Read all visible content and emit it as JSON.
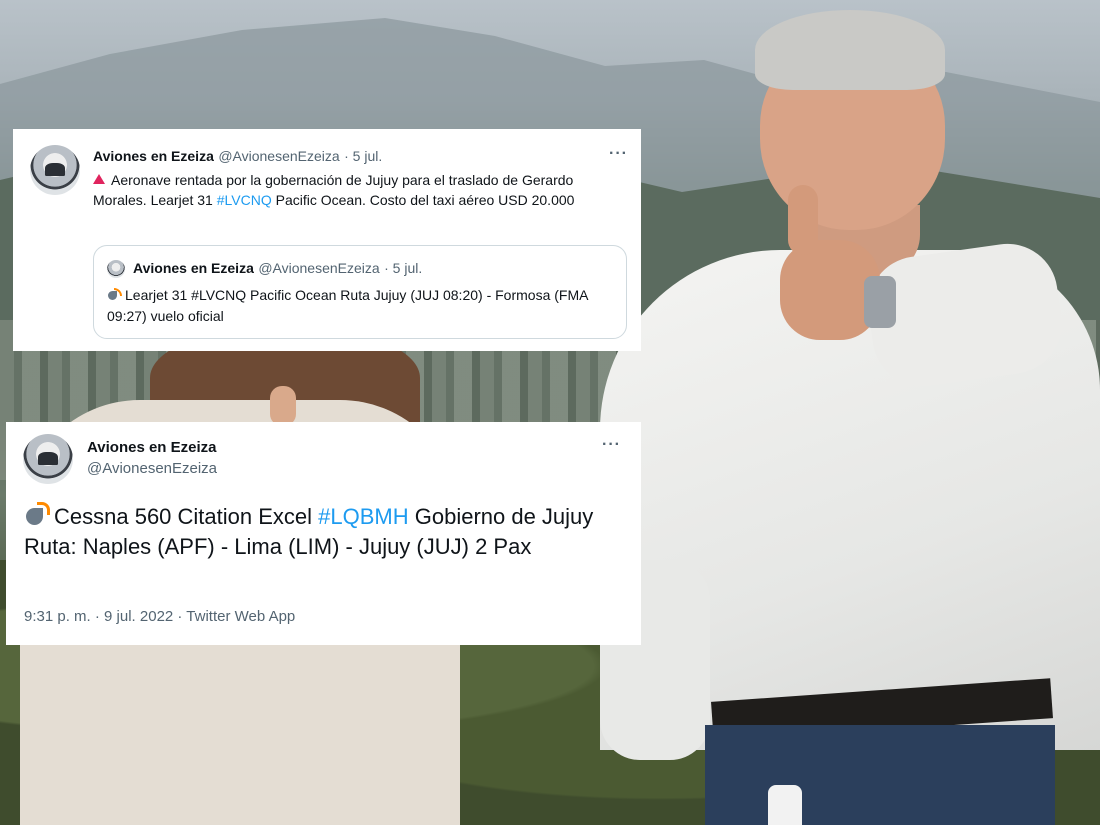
{
  "tweet_quote": {
    "author_name": "Aviones en Ezeiza",
    "author_handle": "@AvionesenEzeiza",
    "date": "· 5 jul.",
    "more": "···",
    "text_before": "Aeronave rentada por la gobernación de Jujuy para el traslado de Gerardo Morales. Learjet 31 ",
    "hashtag": "#LVCNQ",
    "text_after": " Pacific Ocean. Costo del taxi aéreo USD 20.000",
    "quoted": {
      "author_name": "Aviones en Ezeiza",
      "author_handle": "@AvionesenEzeiza",
      "date": "· 5 jul.",
      "text": "Learjet 31 #LVCNQ Pacific Ocean Ruta Jujuy (JUJ 08:20) - Formosa (FMA 09:27) vuelo oficial"
    }
  },
  "tweet_main": {
    "author_name": "Aviones en Ezeiza",
    "author_handle": "@AvionesenEzeiza",
    "more": "···",
    "text_before": "Cessna 560 Citation Excel ",
    "hashtag": "#LQBMH",
    "text_after": " Gobierno de Jujuy Ruta: Naples (APF) - Lima (LIM) - Jujuy (JUJ) 2 Pax",
    "meta": "9:31 p. m. · 9 jul. 2022 · Twitter Web App"
  },
  "icons": {
    "alert": "red-triangle-icon",
    "satellite": "satellite-antenna-icon",
    "more": "more-options-icon"
  },
  "colors": {
    "link": "#1d9bf0",
    "muted": "#536471",
    "text": "#0f1419",
    "alert": "#e0245e"
  }
}
